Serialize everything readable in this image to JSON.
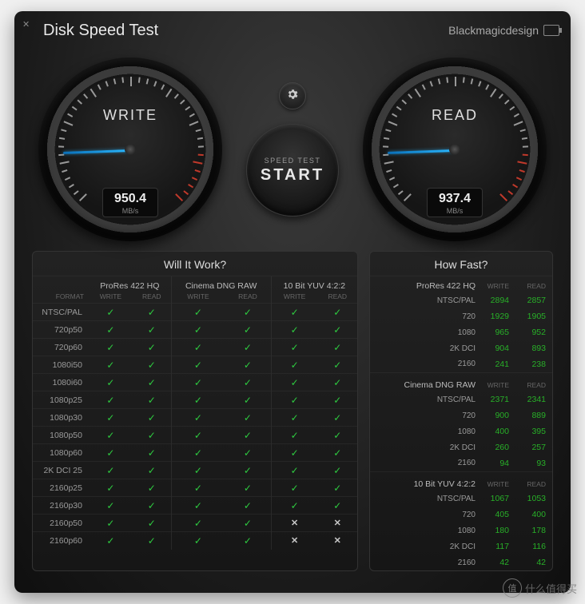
{
  "app": {
    "title": "Disk Speed Test",
    "brand": "Blackmagicdesign"
  },
  "gauges": {
    "write": {
      "label": "WRITE",
      "value": "950.4",
      "unit": "MB/s"
    },
    "read": {
      "label": "READ",
      "value": "937.4",
      "unit": "MB/s"
    }
  },
  "start": {
    "line1": "SPEED TEST",
    "line2": "START"
  },
  "willItWork": {
    "title": "Will It Work?",
    "formatLabel": "FORMAT",
    "subWrite": "WRITE",
    "subRead": "READ",
    "codecs": [
      "ProRes 422 HQ",
      "Cinema DNG RAW",
      "10 Bit YUV 4:2:2"
    ],
    "rows": [
      {
        "name": "NTSC/PAL",
        "cells": [
          "y",
          "y",
          "y",
          "y",
          "y",
          "y"
        ]
      },
      {
        "name": "720p50",
        "cells": [
          "y",
          "y",
          "y",
          "y",
          "y",
          "y"
        ]
      },
      {
        "name": "720p60",
        "cells": [
          "y",
          "y",
          "y",
          "y",
          "y",
          "y"
        ]
      },
      {
        "name": "1080i50",
        "cells": [
          "y",
          "y",
          "y",
          "y",
          "y",
          "y"
        ]
      },
      {
        "name": "1080i60",
        "cells": [
          "y",
          "y",
          "y",
          "y",
          "y",
          "y"
        ]
      },
      {
        "name": "1080p25",
        "cells": [
          "y",
          "y",
          "y",
          "y",
          "y",
          "y"
        ]
      },
      {
        "name": "1080p30",
        "cells": [
          "y",
          "y",
          "y",
          "y",
          "y",
          "y"
        ]
      },
      {
        "name": "1080p50",
        "cells": [
          "y",
          "y",
          "y",
          "y",
          "y",
          "y"
        ]
      },
      {
        "name": "1080p60",
        "cells": [
          "y",
          "y",
          "y",
          "y",
          "y",
          "y"
        ]
      },
      {
        "name": "2K DCI 25",
        "cells": [
          "y",
          "y",
          "y",
          "y",
          "y",
          "y"
        ]
      },
      {
        "name": "2160p25",
        "cells": [
          "y",
          "y",
          "y",
          "y",
          "y",
          "y"
        ]
      },
      {
        "name": "2160p30",
        "cells": [
          "y",
          "y",
          "y",
          "y",
          "y",
          "y"
        ]
      },
      {
        "name": "2160p50",
        "cells": [
          "y",
          "y",
          "y",
          "y",
          "x",
          "x"
        ]
      },
      {
        "name": "2160p60",
        "cells": [
          "y",
          "y",
          "y",
          "y",
          "x",
          "x"
        ]
      }
    ]
  },
  "howFast": {
    "title": "How Fast?",
    "subWrite": "WRITE",
    "subRead": "READ",
    "groups": [
      {
        "name": "ProRes 422 HQ",
        "rows": [
          {
            "name": "NTSC/PAL",
            "write": "2894",
            "read": "2857"
          },
          {
            "name": "720",
            "write": "1929",
            "read": "1905"
          },
          {
            "name": "1080",
            "write": "965",
            "read": "952"
          },
          {
            "name": "2K DCI",
            "write": "904",
            "read": "893"
          },
          {
            "name": "2160",
            "write": "241",
            "read": "238"
          }
        ]
      },
      {
        "name": "Cinema DNG RAW",
        "rows": [
          {
            "name": "NTSC/PAL",
            "write": "2371",
            "read": "2341"
          },
          {
            "name": "720",
            "write": "900",
            "read": "889"
          },
          {
            "name": "1080",
            "write": "400",
            "read": "395"
          },
          {
            "name": "2K DCI",
            "write": "260",
            "read": "257"
          },
          {
            "name": "2160",
            "write": "94",
            "read": "93"
          }
        ]
      },
      {
        "name": "10 Bit YUV 4:2:2",
        "rows": [
          {
            "name": "NTSC/PAL",
            "write": "1067",
            "read": "1053"
          },
          {
            "name": "720",
            "write": "405",
            "read": "400"
          },
          {
            "name": "1080",
            "write": "180",
            "read": "178"
          },
          {
            "name": "2K DCI",
            "write": "117",
            "read": "116"
          },
          {
            "name": "2160",
            "write": "42",
            "read": "42"
          }
        ]
      }
    ]
  },
  "watermark": {
    "badge": "值",
    "text": "什么值得买"
  }
}
